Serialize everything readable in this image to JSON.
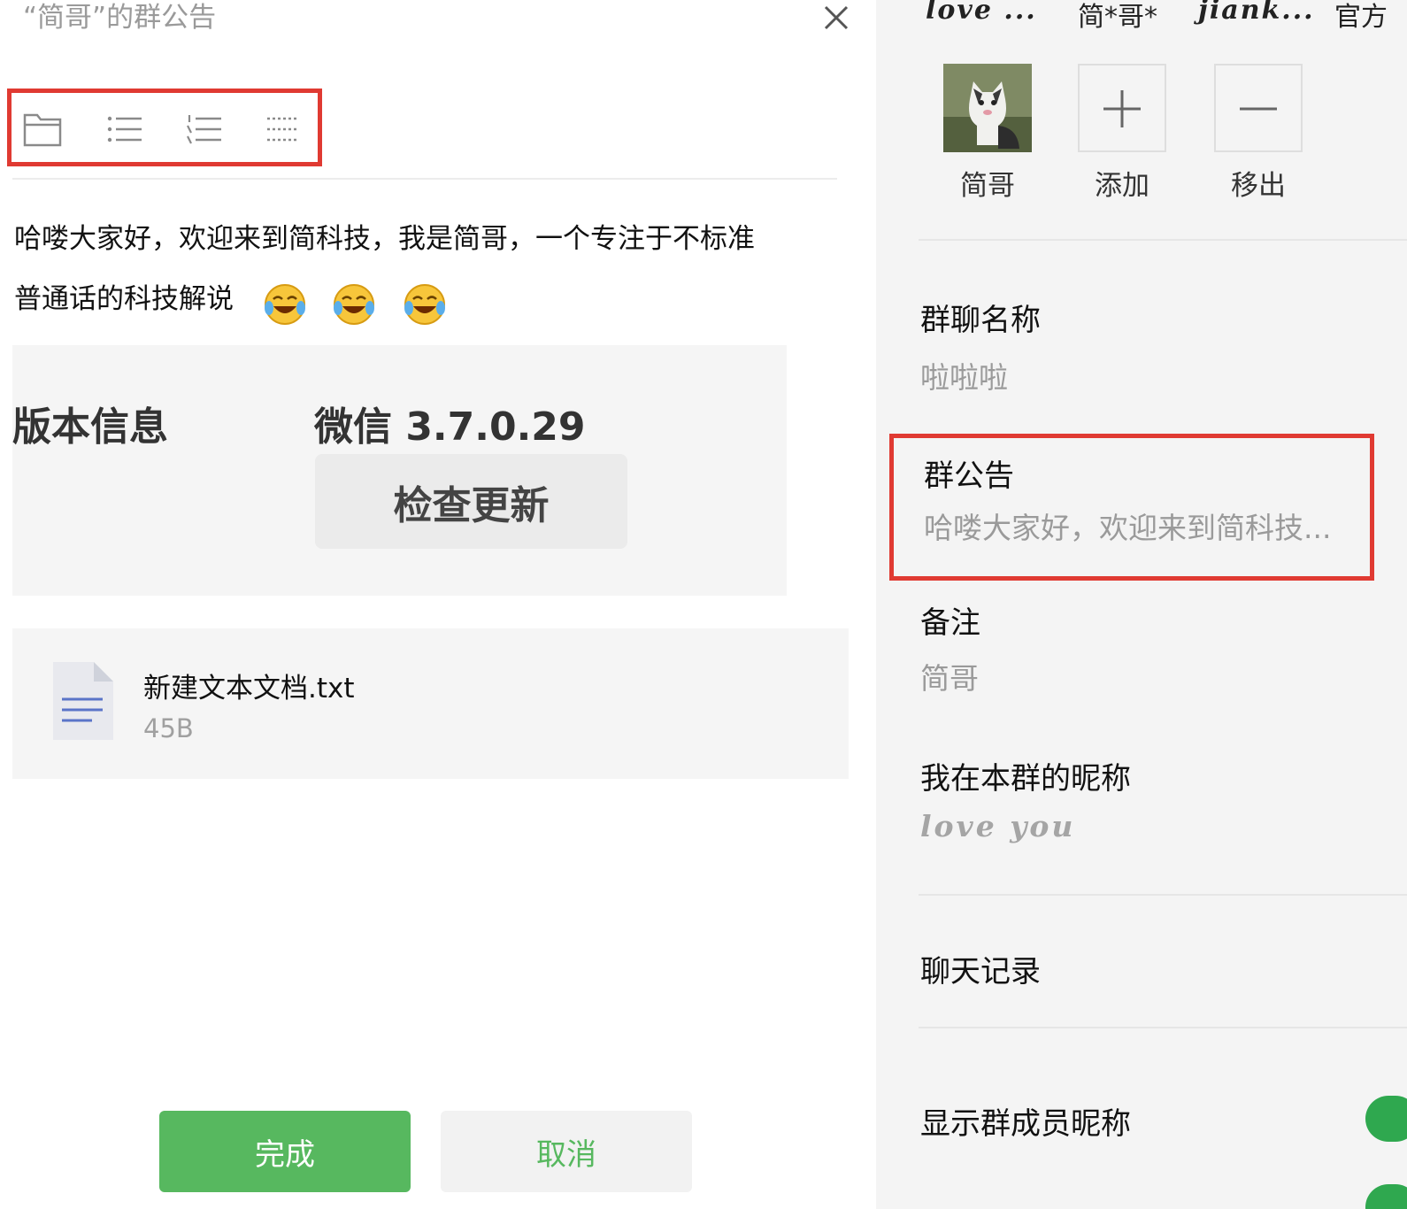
{
  "left": {
    "title": "“简哥”的群公告",
    "toolbar": {
      "icons": [
        "folder-icon",
        "bullet-list-icon",
        "numbered-list-icon",
        "divider-icon"
      ]
    },
    "body": {
      "line1": "哈喽大家好，欢迎来到简科技，我是简哥，一个专注于不标准",
      "line2": "普通话的科技解说",
      "emoji_name": "laughing-crying-emoji"
    },
    "image_block": {
      "version_label": "版本信息",
      "version_value": "微信 3.7.0.29",
      "check_update": "检查更新"
    },
    "file": {
      "name": "新建文本文档.txt",
      "size": "45B"
    },
    "buttons": {
      "done": "完成",
      "cancel": "取消"
    },
    "colors": {
      "accent_green": "#57b85f",
      "highlight_red": "#e03a32"
    }
  },
  "right": {
    "tabs": [
      "love ...",
      "简*哥*",
      "jiank...",
      "官方"
    ],
    "members": [
      {
        "label": "简哥"
      },
      {
        "label": "添加"
      },
      {
        "label": "移出"
      }
    ],
    "group_name": {
      "title": "群聊名称",
      "value": "啦啦啦"
    },
    "notice": {
      "title": "群公告",
      "value": "哈喽大家好，欢迎来到简科技..."
    },
    "remark": {
      "title": "备注",
      "value": "简哥"
    },
    "my_nickname": {
      "title": "我在本群的昵称",
      "value": "love you"
    },
    "chat_history": {
      "title": "聊天记录"
    },
    "show_nicknames": {
      "title": "显示群成员昵称",
      "enabled": true
    }
  }
}
